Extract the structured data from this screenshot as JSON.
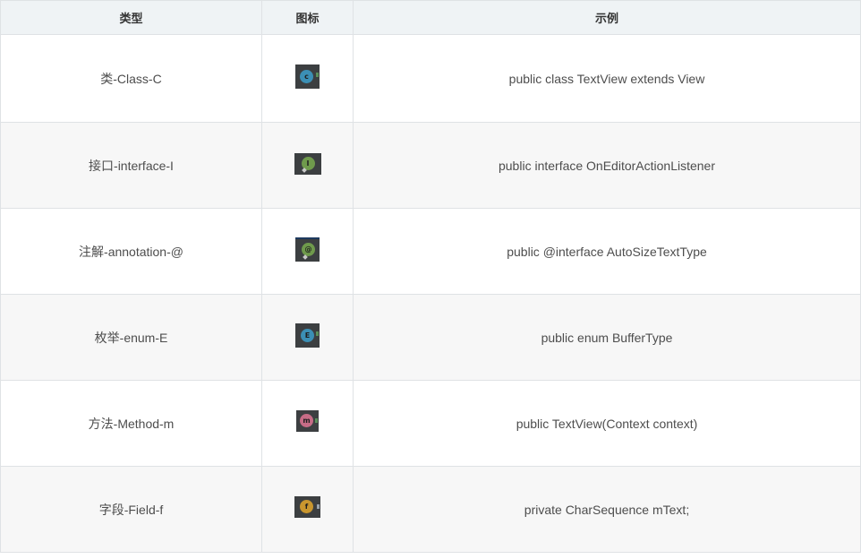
{
  "table": {
    "headers": [
      "类型",
      "图标",
      "示例"
    ],
    "rows": [
      {
        "type": "类-Class-C",
        "icon": "class-icon",
        "icon_letter": "c",
        "icon_color": "#3b8fb5",
        "example": "public class TextView extends View"
      },
      {
        "type": "接口-interface-I",
        "icon": "interface-icon",
        "icon_letter": "I",
        "icon_color": "#6f9a4c",
        "example": "public interface OnEditorActionListener"
      },
      {
        "type": "注解-annotation-@",
        "icon": "annotation-icon",
        "icon_letter": "@",
        "icon_color": "#6f9a4c",
        "example": "public @interface AutoSizeTextType"
      },
      {
        "type": "枚举-enum-E",
        "icon": "enum-icon",
        "icon_letter": "E",
        "icon_color": "#3b8fb5",
        "example": "public enum BufferType"
      },
      {
        "type": "方法-Method-m",
        "icon": "method-icon",
        "icon_letter": "m",
        "icon_color": "#c66c86",
        "example": "public TextView(Context context)"
      },
      {
        "type": "字段-Field-f",
        "icon": "field-icon",
        "icon_letter": "f",
        "icon_color": "#c9962e",
        "example": "private CharSequence mText;"
      }
    ]
  }
}
